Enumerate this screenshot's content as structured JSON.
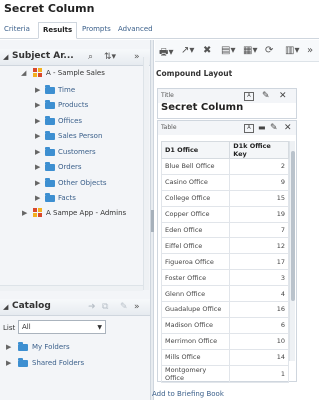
{
  "page": {
    "title": "Secret Column"
  },
  "tabs": [
    {
      "label": "Criteria",
      "active": false
    },
    {
      "label": "Results",
      "active": true
    },
    {
      "label": "Prompts",
      "active": false
    },
    {
      "label": "Advanced",
      "active": false
    }
  ],
  "subject_areas": {
    "title": "Subject Ar...",
    "root": "A - Sample Sales",
    "folders": [
      "Time",
      "Products",
      "Offices",
      "Sales Person",
      "Customers",
      "Orders",
      "Other Objects",
      "Facts"
    ],
    "second_root": "A Sampe App - Admins"
  },
  "catalog": {
    "title": "Catalog",
    "list_label": "List",
    "list_value": "All",
    "folders": [
      "My Folders",
      "Shared Folders"
    ]
  },
  "layout": {
    "heading": "Compound Layout",
    "title_view": {
      "type_label": "Title",
      "text": "Secret Column"
    },
    "table_view": {
      "type_label": "Table",
      "columns": [
        "D1 Office",
        "D1k Office Key"
      ],
      "rows": [
        [
          "Blue Bell Office",
          "2"
        ],
        [
          "Casino Office",
          "9"
        ],
        [
          "College Office",
          "15"
        ],
        [
          "Copper Office",
          "19"
        ],
        [
          "Eden Office",
          "7"
        ],
        [
          "Eiffel Office",
          "12"
        ],
        [
          "Figueroa Office",
          "17"
        ],
        [
          "Foster Office",
          "3"
        ],
        [
          "Glenn Office",
          "4"
        ],
        [
          "Guadalupe Office",
          "16"
        ],
        [
          "Madison Office",
          "6"
        ],
        [
          "Merrimon Office",
          "10"
        ],
        [
          "Mills Office",
          "14"
        ],
        [
          "Montgomery Office",
          "1"
        ]
      ]
    },
    "briefing_link": "Add to Briefing Book"
  },
  "colors": {
    "link": "#3a5f8a",
    "folder": "#3d8fd1",
    "subject_red": "#d9482b",
    "subject_yellow": "#f2b01e"
  }
}
